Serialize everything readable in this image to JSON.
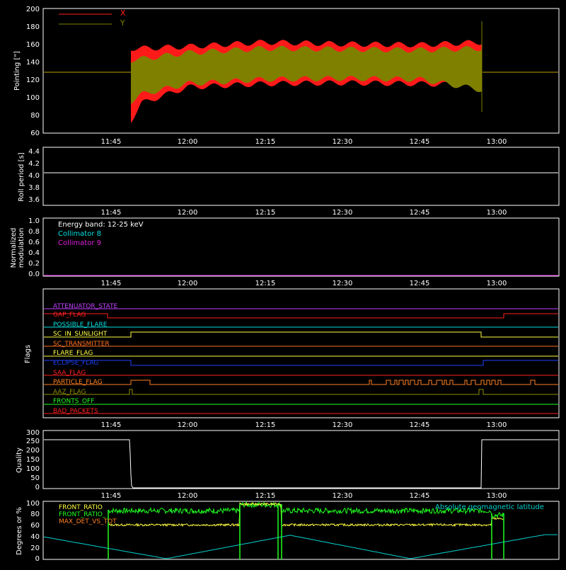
{
  "panels": {
    "pointing": {
      "ylabel": "Pointing [\"]",
      "yticks": [
        "60",
        "80",
        "100",
        "120",
        "140",
        "160",
        "180",
        "200"
      ],
      "legend": [
        {
          "label": "X",
          "color": "#ff2020"
        },
        {
          "label": "Y",
          "color": "#808000"
        }
      ]
    },
    "roll": {
      "ylabel": "Roll period [s]",
      "yticks": [
        "3.6",
        "3.8",
        "4.0",
        "4.2",
        "4.4"
      ]
    },
    "modulation": {
      "ylabel_line1": "Normalized",
      "ylabel_line2": "modulation",
      "yticks": [
        "0.0",
        "0.2",
        "0.4",
        "0.6",
        "0.8",
        "1.0"
      ],
      "legend": [
        {
          "label": "Energy band: 12-25 keV",
          "color": "#ffffff"
        },
        {
          "label": "Collimator 8",
          "color": "#00e0e0"
        },
        {
          "label": "Collimator 9",
          "color": "#e020e0"
        }
      ]
    },
    "flags": {
      "ylabel": "Flags",
      "items": [
        {
          "label": "ATTENUATOR_STATE",
          "color": "#c040ff"
        },
        {
          "label": "GAP_FLAG",
          "color": "#ff2020"
        },
        {
          "label": "POSSIBLE_FLARE",
          "color": "#00e0e0"
        },
        {
          "label": "SC_IN_SUNLIGHT",
          "color": "#ffff40"
        },
        {
          "label": "SC_TRANSMITTER",
          "color": "#ff7020"
        },
        {
          "label": "FLARE_FLAG",
          "color": "#ffff40"
        },
        {
          "label": "ECLIPSE_FLAG",
          "color": "#2040ff"
        },
        {
          "label": "SAA_FLAG",
          "color": "#ff2020"
        },
        {
          "label": "PARTICLE_FLAG",
          "color": "#ff8020"
        },
        {
          "label": "AAZ_FLAG",
          "color": "#909000"
        },
        {
          "label": "FRONTS_OFF",
          "color": "#20ff20"
        },
        {
          "label": "BAD_PACKETS",
          "color": "#ff2020"
        }
      ]
    },
    "quality": {
      "ylabel": "Quality",
      "yticks": [
        "0",
        "50",
        "100",
        "150",
        "200",
        "250",
        "300"
      ]
    },
    "degrees": {
      "ylabel": "Degrees or %",
      "yticks": [
        "0",
        "20",
        "40",
        "60",
        "80",
        "100"
      ],
      "legend": [
        {
          "label": "FRONT_RATIO",
          "color": "#ffff40"
        },
        {
          "label": "FRONT_RATIO_",
          "color": "#20ff20"
        },
        {
          "label": "MAX_DET_VS_TOT",
          "color": "#ff8020"
        }
      ],
      "right_label": {
        "label": "Absolute geomagnetic latitude",
        "color": "#00d0d0"
      }
    }
  },
  "xticks": [
    "11:45",
    "12:00",
    "12:15",
    "12:30",
    "12:45",
    "13:00"
  ],
  "chart_data": [
    {
      "type": "line",
      "ylabel": "Pointing [\"]",
      "ylim": [
        60,
        200
      ],
      "x_tick_labels": [
        "11:45",
        "12:00",
        "12:15",
        "12:30",
        "12:45",
        "13:00"
      ],
      "series": [
        {
          "name": "X",
          "color": "#ff2020",
          "envelope_time": [
            "11:48",
            "11:50",
            "12:00",
            "12:15",
            "12:30",
            "12:45",
            "12:58"
          ],
          "envelope_min": [
            70,
            90,
            108,
            112,
            113,
            112,
            110
          ],
          "envelope_max": [
            158,
            158,
            160,
            165,
            163,
            162,
            165
          ]
        },
        {
          "name": "Y",
          "color": "#808000",
          "envelope_time": [
            "11:48",
            "11:50",
            "12:00",
            "12:15",
            "12:30",
            "12:45",
            "12:58"
          ],
          "envelope_min": [
            92,
            100,
            112,
            117,
            118,
            117,
            105
          ],
          "envelope_max": [
            145,
            146,
            153,
            158,
            157,
            156,
            158
          ]
        }
      ]
    },
    {
      "type": "line",
      "ylabel": "Roll period [s]",
      "ylim": [
        3.5,
        4.5
      ],
      "series": [
        {
          "values": [
            4.05,
            4.05
          ],
          "time": [
            "11:31",
            "13:12"
          ],
          "color": "#ffffff"
        }
      ]
    },
    {
      "type": "line",
      "ylabel": "Normalized modulation",
      "ylim": [
        0,
        1
      ],
      "series": [
        {
          "name": "Collimator 8",
          "time": [
            "11:31",
            "13:12"
          ],
          "values": [
            0,
            0
          ],
          "color": "#00e0e0"
        },
        {
          "name": "Collimator 9",
          "time": [
            "11:31",
            "13:12"
          ],
          "values": [
            0,
            0
          ],
          "color": "#e020e0"
        }
      ]
    },
    {
      "type": "line",
      "ylabel": "Quality",
      "ylim": [
        0,
        300
      ],
      "series": [
        {
          "time": [
            "11:31",
            "11:48",
            "11:48.5",
            "12:58",
            "12:58.1",
            "13:12"
          ],
          "values": [
            255,
            255,
            0,
            0,
            255,
            255
          ],
          "color": "#ffffff"
        }
      ]
    },
    {
      "type": "line",
      "ylabel": "Degrees or %",
      "ylim": [
        0,
        100
      ],
      "series": [
        {
          "name": "FRONT_RATIO",
          "color": "#ffff40",
          "time": [
            "11:43",
            "12:08",
            "12:09",
            "12:15",
            "12:18",
            "12:57",
            "12:59"
          ],
          "values": [
            60,
            62,
            100,
            100,
            62,
            60,
            73
          ]
        },
        {
          "name": "FRONT_RATIO_",
          "color": "#20ff20",
          "time": [
            "11:43",
            "12:08",
            "12:09",
            "12:15",
            "12:18",
            "12:57",
            "12:59"
          ],
          "values": [
            88,
            90,
            100,
            100,
            90,
            88,
            80
          ]
        },
        {
          "name": "Absolute geomagnetic latitude",
          "color": "#00d0d0",
          "time": [
            "11:31",
            "11:54",
            "12:19",
            "12:44",
            "13:10"
          ],
          "values": [
            40,
            0,
            43,
            0,
            44
          ]
        }
      ]
    }
  ]
}
